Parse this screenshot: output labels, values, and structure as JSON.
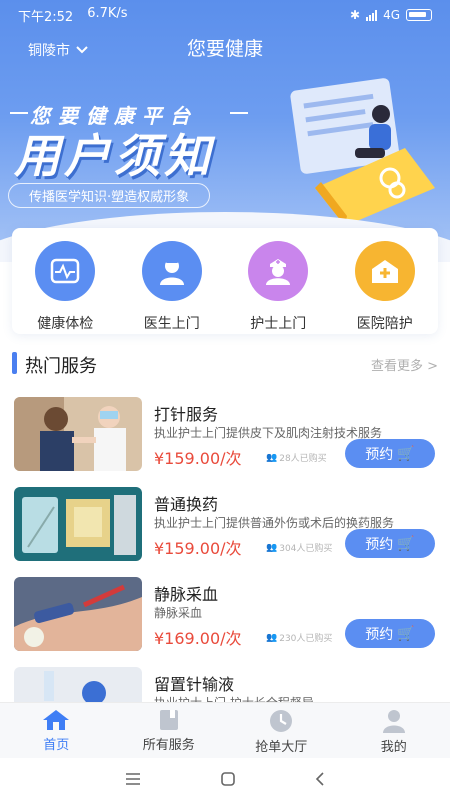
{
  "status": {
    "time": "下午2:52",
    "speed": "6.7K/s",
    "network": "4G"
  },
  "header": {
    "city": "铜陵市",
    "title": "您要健康"
  },
  "banner": {
    "line1": "您要健康平台",
    "line2": "用户须知",
    "subtitle": "传播医学知识·塑造权威形象"
  },
  "categories": [
    {
      "label": "健康体检",
      "icon": "health-checkup-icon",
      "color": "#5b8ef2"
    },
    {
      "label": "医生上门",
      "icon": "doctor-icon",
      "color": "#5b8ef2"
    },
    {
      "label": "护士上门",
      "icon": "nurse-icon",
      "color": "#c985ec"
    },
    {
      "label": "医院陪护",
      "icon": "hospital-icon",
      "color": "#f7b531"
    }
  ],
  "section": {
    "title": "热门服务",
    "more": "查看更多 >"
  },
  "services": [
    {
      "name": "打针服务",
      "desc": "执业护士上门提供皮下及肌肉注射技术服务",
      "price": "¥159.00/次",
      "bought": "28人已购买",
      "button": "预约"
    },
    {
      "name": "普通换药",
      "desc": "执业护士上门提供普通外伤或术后的换药服务",
      "price": "¥159.00/次",
      "bought": "304人已购买",
      "button": "预约"
    },
    {
      "name": "静脉采血",
      "desc": "静脉采血",
      "price": "¥169.00/次",
      "bought": "230人已购买",
      "button": "预约"
    },
    {
      "name": "留置针输液",
      "desc": "执业护士上门,护士长全程督导",
      "price": "",
      "bought": "",
      "button": ""
    }
  ],
  "tabs": [
    {
      "label": "首页",
      "icon": "home-icon",
      "active": true
    },
    {
      "label": "所有服务",
      "icon": "book-icon",
      "active": false
    },
    {
      "label": "抢单大厅",
      "icon": "clock-icon",
      "active": false
    },
    {
      "label": "我的",
      "icon": "user-icon",
      "active": false
    }
  ],
  "colors": {
    "primary": "#5b8ef2",
    "price": "#e94b3c",
    "active_tab": "#3f7ef5"
  }
}
